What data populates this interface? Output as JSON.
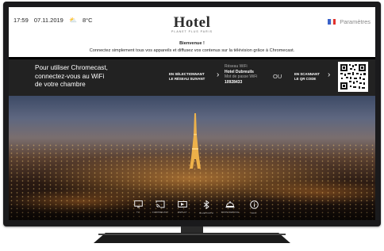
{
  "status": {
    "time": "17:59",
    "date": "07.11.2019",
    "weather_icon": "cloud-sun-icon",
    "temperature": "8°C"
  },
  "brand": {
    "name": "Hotel",
    "tagline": "PLANET PLUS PARIS"
  },
  "settings": {
    "flag_colors": [
      "#3a62c9",
      "#ffffff",
      "#e2312d"
    ],
    "label": "Paramètres"
  },
  "welcome": {
    "title": "Bienvenue !",
    "text": "Connectez simplement tous vos appareils et diffusez vos contenus sur la télévision grâce à Chromecast."
  },
  "chromecast": {
    "lead_line1": "Pour utiliser Chromecast,",
    "lead_line2": "connectez-vous au WiFi",
    "lead_line3": "de votre chambre",
    "step1_line1": "EN SÉLECTIONNANT",
    "step1_line2": "LE RÉSEAU SUIVANT",
    "network_label": "Réseau WiFi",
    "network_value": "Hotel Dubreuils",
    "password_label": "Mot de passe WiFi",
    "password_value": "10928433",
    "or": "OU",
    "step2_line1": "EN SCANNANT",
    "step2_line2": "LE QR CODE"
  },
  "dock": [
    {
      "name": "tv",
      "icon": "monitor-icon",
      "label": "TV"
    },
    {
      "name": "chromecast",
      "icon": "cast-icon",
      "label": "CHROMECAST"
    },
    {
      "name": "replay",
      "icon": "replay-icon",
      "label": "REPLAY"
    },
    {
      "name": "bluetooth",
      "icon": "bluetooth-icon",
      "label": "BLUETOOTH"
    },
    {
      "name": "room-service",
      "icon": "cloche-icon",
      "label": "ROOM SERVICE"
    },
    {
      "name": "info",
      "icon": "info-icon",
      "label": "INFO"
    }
  ]
}
